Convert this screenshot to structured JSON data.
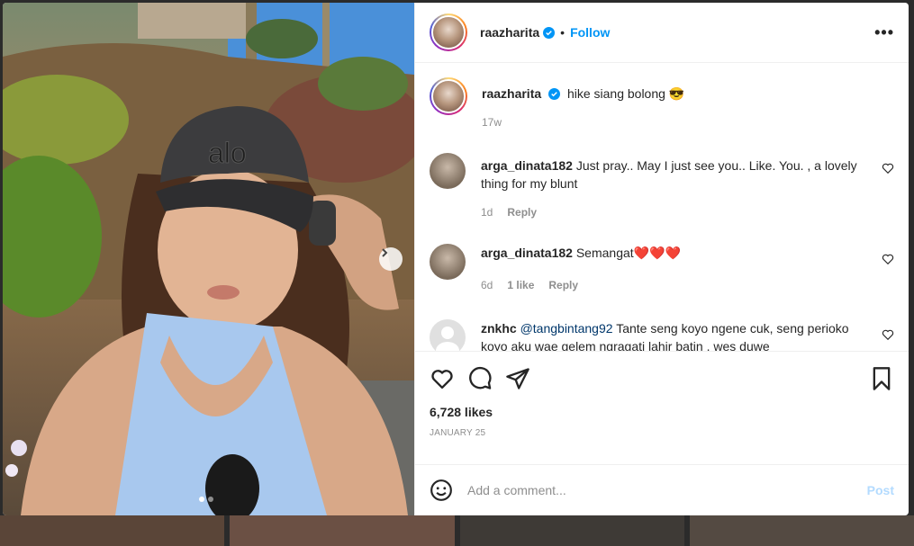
{
  "post": {
    "username": "raazharita",
    "follow_label": "Follow",
    "separator": "•",
    "more_label": "•••",
    "caption": "hike siang bolong",
    "caption_emoji": "😎",
    "caption_time": "17w",
    "likes": "6,728 likes",
    "date": "JANUARY 25"
  },
  "comments": [
    {
      "username": "arga_dinata182",
      "text": "Just pray.. May I just see you.. Like. You. , a lovely thing for my blunt",
      "time": "1d",
      "likes": "",
      "reply_label": "Reply"
    },
    {
      "username": "arga_dinata182",
      "text": "Semangat",
      "emojis": "❤️❤️❤️",
      "time": "6d",
      "likes": "1 like",
      "reply_label": "Reply"
    },
    {
      "username": "znkhc",
      "mention": "@tangbintang92",
      "text": "Tante seng koyo ngene cuk, seng perioko koyo aku wae gelem ngragati lahir batin . wes duwe"
    }
  ],
  "add_comment": {
    "placeholder": "Add a comment...",
    "post_label": "Post"
  },
  "colors": {
    "accent": "#0095f6",
    "post_disabled": "#b3dbff",
    "meta_gray": "#8e8e8e"
  },
  "icons": {
    "like": "heart-icon",
    "comment": "comment-icon",
    "share": "share-icon",
    "save": "bookmark-icon",
    "next": "chevron-right-icon",
    "emoji": "emoji-icon"
  }
}
